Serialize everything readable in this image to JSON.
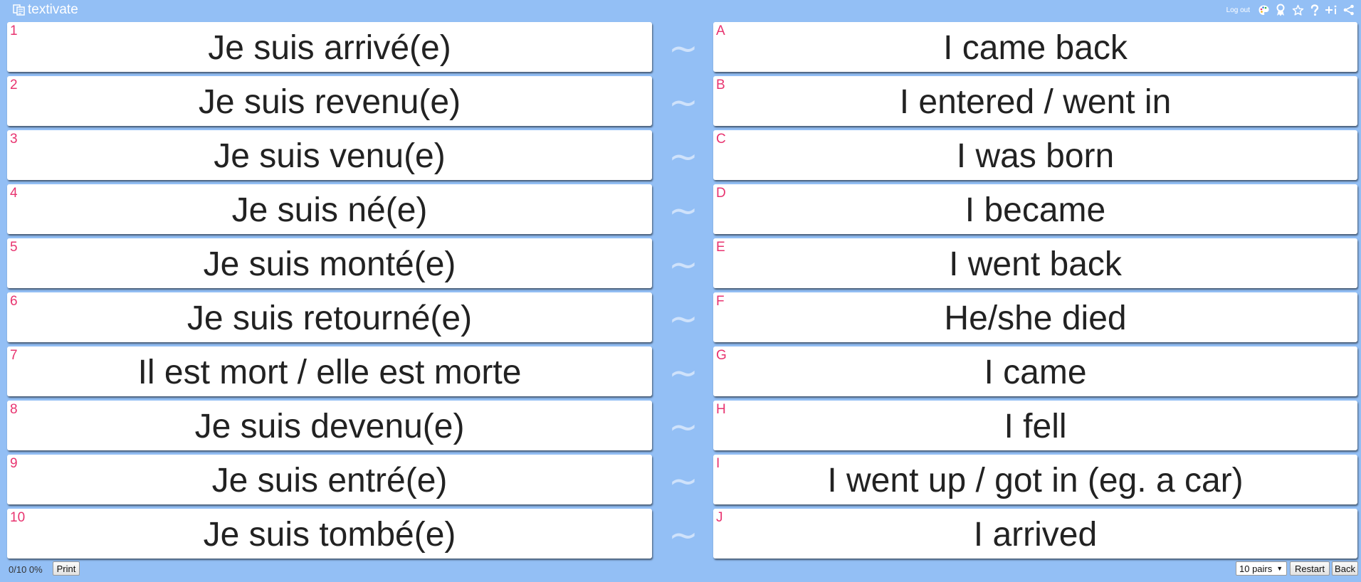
{
  "app": {
    "name": "textivate",
    "logout_label": "Log out",
    "icons": [
      "palette-icon",
      "ribbon-icon",
      "star-icon",
      "help-icon",
      "add-info-icon",
      "share-icon"
    ]
  },
  "game": {
    "left_cards": [
      {
        "tag": "1",
        "text": "Je suis arrivé(e)"
      },
      {
        "tag": "2",
        "text": "Je suis revenu(e)"
      },
      {
        "tag": "3",
        "text": "Je suis venu(e)"
      },
      {
        "tag": "4",
        "text": "Je suis né(e)"
      },
      {
        "tag": "5",
        "text": "Je suis monté(e)"
      },
      {
        "tag": "6",
        "text": "Je suis retourné(e)"
      },
      {
        "tag": "7",
        "text": "Il est mort / elle est morte"
      },
      {
        "tag": "8",
        "text": "Je suis devenu(e)"
      },
      {
        "tag": "9",
        "text": "Je suis entré(e)"
      },
      {
        "tag": "10",
        "text": "Je suis tombé(e)"
      }
    ],
    "right_cards": [
      {
        "tag": "A",
        "text": "I came back"
      },
      {
        "tag": "B",
        "text": "I entered / went in"
      },
      {
        "tag": "C",
        "text": "I was born"
      },
      {
        "tag": "D",
        "text": "I became"
      },
      {
        "tag": "E",
        "text": "I went back"
      },
      {
        "tag": "F",
        "text": "He/she died"
      },
      {
        "tag": "G",
        "text": "I came"
      },
      {
        "tag": "H",
        "text": "I fell"
      },
      {
        "tag": "I",
        "text": "I went up / got in (eg. a car)"
      },
      {
        "tag": "J",
        "text": "I arrived"
      }
    ],
    "separator": "~"
  },
  "footer": {
    "score": "0/10 0%",
    "print_label": "Print",
    "pairs_select": "10 pairs",
    "restart_label": "Restart",
    "back_label": "Back"
  },
  "colors": {
    "background": "#93bff5",
    "card": "#ffffff",
    "tag": "#e8336f",
    "text": "#222222"
  }
}
